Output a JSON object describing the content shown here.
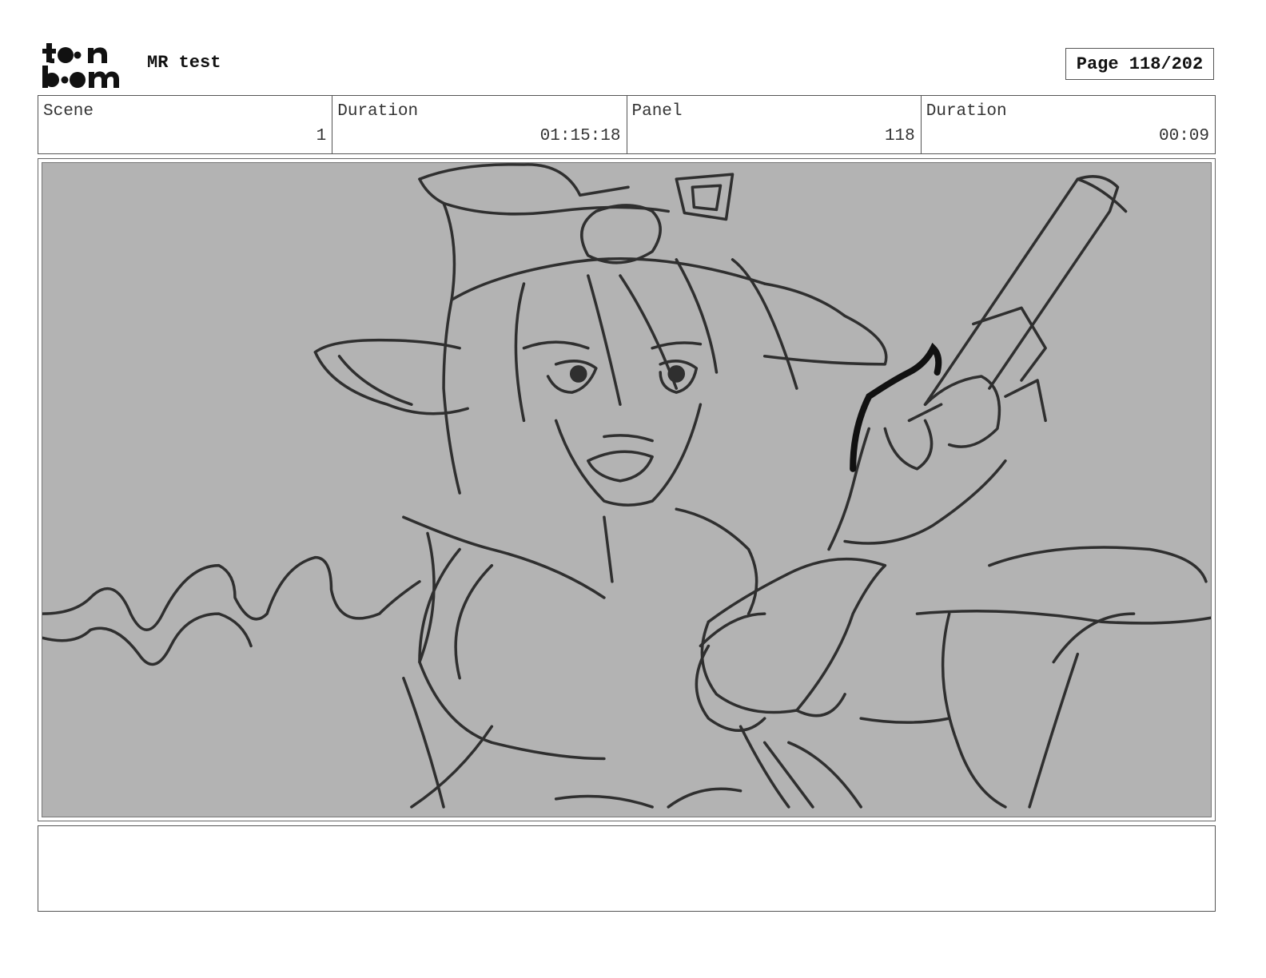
{
  "header": {
    "logo_text_line1": "toon",
    "logo_text_line2": "boom",
    "project_title": "MR test",
    "page_label": "Page 118/202"
  },
  "info": {
    "scene_label": "Scene",
    "scene_value": "1",
    "scene_duration_label": "Duration",
    "scene_duration_value": "01:15:18",
    "panel_label": "Panel",
    "panel_value": "118",
    "panel_duration_label": "Duration",
    "panel_duration_value": "00:09"
  },
  "panel": {
    "background_color": "#b3b3b3",
    "stroke_color": "#2f2f2f",
    "image_description": "sketch-character-with-pistol"
  },
  "notes": {
    "text": ""
  }
}
